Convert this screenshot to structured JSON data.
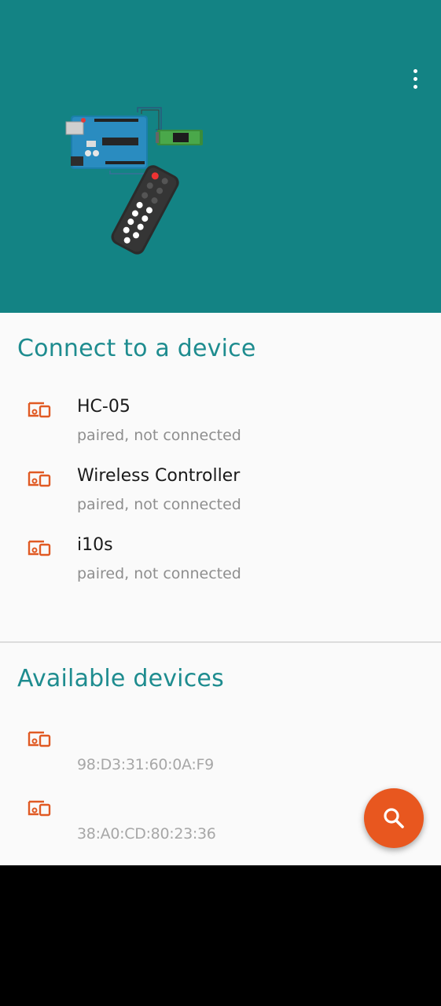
{
  "colors": {
    "header": "#138384",
    "accent_title": "#1e8c8f",
    "device_icon": "#e05a24",
    "fab": "#e8571f"
  },
  "header": {
    "menu_icon": "overflow-menu-icon",
    "illustration": "arduino-bluetooth-remote-illustration"
  },
  "paired": {
    "title": "Connect to a device",
    "devices": [
      {
        "name": "HC-05",
        "status": "paired, not connected",
        "icon": "bluetooth-device-icon"
      },
      {
        "name": "Wireless Controller",
        "status": "paired, not connected",
        "icon": "bluetooth-device-icon"
      },
      {
        "name": "i10s",
        "status": "paired, not connected",
        "icon": "bluetooth-device-icon"
      }
    ]
  },
  "available": {
    "title": "Available devices",
    "devices": [
      {
        "name": "",
        "address": "98:D3:31:60:0A:F9",
        "icon": "bluetooth-device-icon"
      },
      {
        "name": "",
        "address": "38:A0:CD:80:23:36",
        "icon": "bluetooth-device-icon"
      }
    ]
  },
  "fab": {
    "icon": "search-icon"
  }
}
